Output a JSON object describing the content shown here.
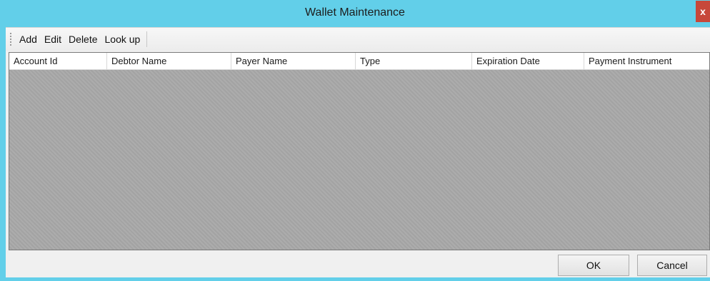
{
  "window": {
    "title": "Wallet Maintenance",
    "close_glyph": "x"
  },
  "toolbar": {
    "items": [
      {
        "label": "Add"
      },
      {
        "label": "Edit"
      },
      {
        "label": "Delete"
      },
      {
        "label": "Look up"
      }
    ]
  },
  "table": {
    "columns": [
      "Account Id",
      "Debtor Name",
      "Payer Name",
      "Type",
      "Expiration Date",
      "Payment Instrument"
    ],
    "rows": []
  },
  "buttons": {
    "ok": "OK",
    "cancel": "Cancel"
  },
  "colors": {
    "titlebar": "#62cfe9",
    "close": "#c7483a",
    "empty_list": "#a8a8a8"
  }
}
